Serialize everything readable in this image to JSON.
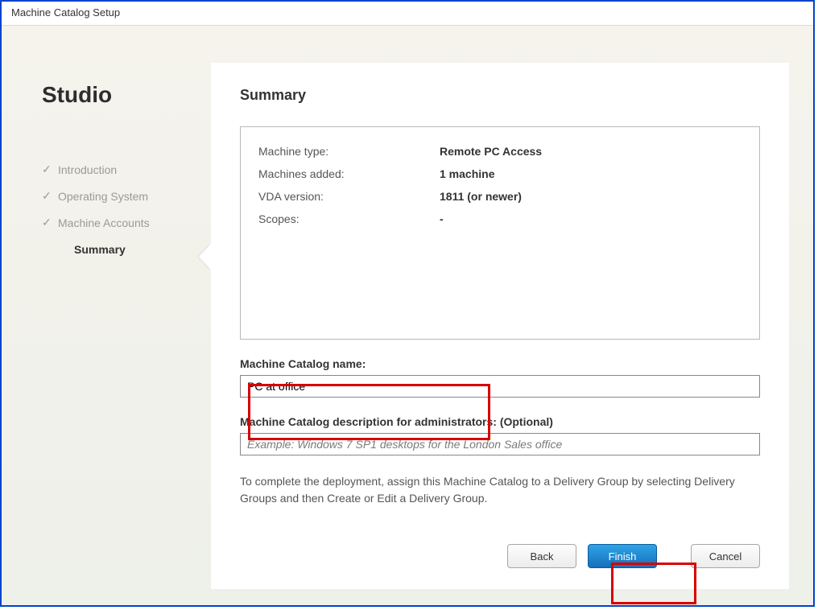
{
  "window": {
    "title": "Machine Catalog Setup"
  },
  "sidebar": {
    "brand": "Studio",
    "steps": [
      {
        "label": "Introduction",
        "done": true,
        "current": false
      },
      {
        "label": "Operating System",
        "done": true,
        "current": false
      },
      {
        "label": "Machine Accounts",
        "done": true,
        "current": false
      },
      {
        "label": "Summary",
        "done": false,
        "current": true
      }
    ]
  },
  "panel": {
    "title": "Summary",
    "summary": {
      "rows": [
        {
          "label": "Machine type:",
          "value": "Remote PC Access"
        },
        {
          "label": "Machines added:",
          "value": "1 machine"
        },
        {
          "label": "VDA version:",
          "value": "1811 (or newer)"
        },
        {
          "label": "Scopes:",
          "value": "-"
        }
      ]
    },
    "catalog_name": {
      "label": "Machine Catalog name:",
      "value": "PC at office"
    },
    "catalog_description": {
      "label": "Machine Catalog description for administrators: (Optional)",
      "value": "",
      "placeholder": "Example: Windows 7 SP1 desktops for the London Sales office"
    },
    "helper": "To complete the deployment, assign this Machine Catalog to a Delivery Group by selecting Delivery Groups and then Create or Edit a Delivery Group."
  },
  "buttons": {
    "back": "Back",
    "finish": "Finish",
    "cancel": "Cancel"
  },
  "annotations": {
    "highlight_name_field": true,
    "highlight_finish_button": true
  }
}
